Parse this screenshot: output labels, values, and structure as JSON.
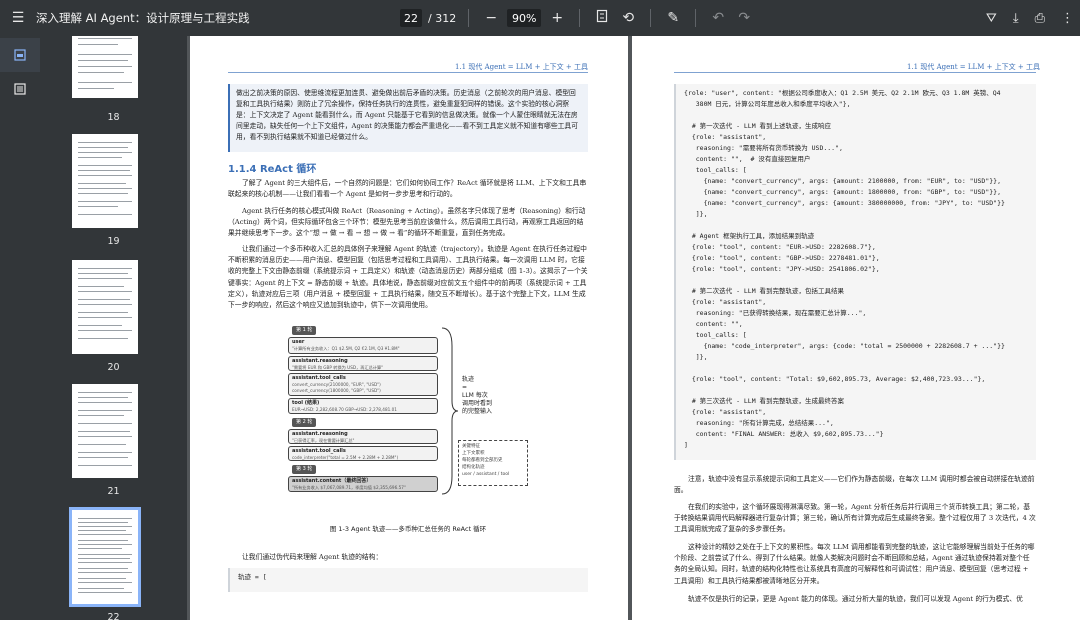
{
  "toolbar": {
    "title": "深入理解 AI Agent：设计原理与工程实践",
    "current_page": "22",
    "total_pages": "/ 312",
    "zoom": "90%"
  },
  "thumbnails": [
    {
      "num": "18"
    },
    {
      "num": "19"
    },
    {
      "num": "20"
    },
    {
      "num": "21"
    },
    {
      "num": "22"
    }
  ],
  "page_left": {
    "running_head": "1.1 现代 Agent = LLM + 上下文 + 工具",
    "callout": "做出之前决策的原因、使思维流程更加连贯、避免做出前后矛盾的决策。历史消息（之前轮次的用户消息、模型回复和工具执行结果）则防止了冗余操作，保持任务执行的连贯性，避免重复犯同样的错误。这个实验的核心洞察是：上下文决定了 Agent 能看到什么，而 Agent 只能基于它看到的信息做决策。就像一个人蒙住眼睛就无法在房间里走动，缺失任何一个上下文组件，Agent 的决策能力都会严重退化——看不到工具定义就不知道有哪些工具可用，看不到执行结果就不知道已经做过什么。",
    "section_title": "1.1.4 ReAct 循环",
    "para1": "了解了 Agent 的三大组件后，一个自然的问题是：它们如何协同工作？ReAct 循环就是将 LLM、上下文和工具串联起来的核心机制——让我们看看一个 Agent 是如何一步步思考和行动的。",
    "para2": "Agent 执行任务的核心模式叫做 ReAct（Reasoning + Acting）。虽然名字只体现了思考（Reasoning）和行动（Acting）两个词，但实际循环包含三个环节：模型先思考当前应该做什么，然后调用工具行动，再观察工具返回的结果并继续思考下一步。这个“想 → 做 → 看 → 想 → 做 → 看”的循环不断重复，直到任务完成。",
    "para3": "让我们通过一个多币种收入汇总的具体例子来理解 Agent 的轨迹（trajectory）。轨迹是 Agent 在执行任务过程中不断积累的消息历史——用户消息、模型回复（包括思考过程和工具调用）、工具执行结果。每一次调用 LLM 时，它接收的完整上下文由静态前缀（系统提示词 + 工具定义）和轨迹（动态消息历史）两部分组成（图 1-3）。这揭示了一个关键事实：Agent 的上下文 = 静态前缀 + 轨迹。具体地说，静态前缀对应前文五个组件中的前两项（系统提示词 + 工具定义），轨迹对应后三项（用户消息 + 模型回复 + 工具执行结果，随交互不断增长）。基于这个完整上下文，LLM 生成下一步的响应，然后这个响应又追加到轨迹中，供下一次调用使用。",
    "fig_caption": "图 1-3  Agent 轨迹——多币种汇总任务的 ReAct 循环",
    "para4": "让我们通过伪代码来理解 Agent 轨迹的结构：",
    "code_start": "轨迹 = ["
  },
  "figure": {
    "turn1": "第 1 轮",
    "user_title": "user",
    "user_sub": "\"计算所有业务收入：Q1 $2.5M, Q2 €2.1M, Q3 ¥1.8M\"",
    "reason1_title": "assistant.reasoning",
    "reason1_sub": "\"需要将 EUR 和 GBP 转换为 USD，再汇总计算\"",
    "tool1_title": "assistant.tool_calls",
    "tool1_sub1": "convert_currency(2100000, \"EUR\", \"USD\")",
    "tool1_sub2": "convert_currency(1800000, \"GBP\", \"USD\")",
    "toolres_title": "tool (结果)",
    "toolres_sub": "EUR→USD: 2,282,608.70      GBP→USD: 2,278,481.01",
    "turn2": "第 2 轮",
    "reason2_title": "assistant.reasoning",
    "reason2_sub": "\"已获得汇率，现在需要计算汇总\"",
    "tool2_title": "assistant.tool_calls",
    "tool2_sub": "code_interpreter(\"total = 2.5M + 2.28M + 2.28M\")",
    "turn3": "第 3 轮",
    "final_title": "assistant.content（最终回答）",
    "final_sub": "\"所有业务收入 $7,067,089.71，季度均值 $2,355,696.57\"",
    "side_label_1": "轨迹",
    "side_label_2": "=",
    "side_label_3": "LLM 每次",
    "side_label_4": "调用时看到",
    "side_label_5": "的完整输入",
    "dash_1": "关键特征",
    "dash_2": "上下文累积",
    "dash_3": "每轮都看到全部历史",
    "dash_4": "结构化轨迹",
    "dash_5": "user / assistant / tool"
  },
  "page_right": {
    "running_head": "1.1 现代 Agent = LLM + 上下文 + 工具",
    "code": "{role: \"user\", content: \"根据公司季度收入：Q1 2.5M 美元、Q2 2.1M 欧元、Q3 1.8M 英镑、Q4\n   380M 日元，计算公司年度总收入和季度平均收入\"},\n\n  # 第一次迭代 - LLM 看到上述轨迹，生成响应\n  {role: \"assistant\",\n   reasoning: \"需要将所有货币转换为 USD...\",\n   content: \"\",  # 没有直接回复用户\n   tool_calls: [\n     {name: \"convert_currency\", args: {amount: 2100000, from: \"EUR\", to: \"USD\"}},\n     {name: \"convert_currency\", args: {amount: 1800000, from: \"GBP\", to: \"USD\"}},\n     {name: \"convert_currency\", args: {amount: 380000000, from: \"JPY\", to: \"USD\"}}\n   ]},\n\n  # Agent 框架执行工具，添加结果到轨迹\n  {role: \"tool\", content: \"EUR->USD: 2282608.7\"},\n  {role: \"tool\", content: \"GBP->USD: 2278481.01\"},\n  {role: \"tool\", content: \"JPY->USD: 2541806.02\"},\n\n  # 第二次迭代 - LLM 看到完整轨迹，包括工具结果\n  {role: \"assistant\",\n   reasoning: \"已获得转换结果，现在需要汇总计算...\",\n   content: \"\",\n   tool_calls: [\n     {name: \"code_interpreter\", args: {code: \"total = 2500000 + 2282608.7 + ...\"}}\n   ]},\n\n  {role: \"tool\", content: \"Total: $9,602,895.73, Average: $2,400,723.93...\"},\n\n  # 第三次迭代 - LLM 看到完整轨迹，生成最终答案\n  {role: \"assistant\",\n   reasoning: \"所有计算完成，总结结果...\",\n   content: \"FINAL ANSWER: 总收入 $9,602,895.73...\"}\n]",
    "para1": "注意，轨迹中没有显示系统提示词和工具定义——它们作为静态前缀，在每次 LLM 调用时都会被自动拼接在轨迹前面。",
    "para2": "在我们的实验中，这个循环展现得淋漓尽致。第一轮，Agent 分析任务后并行调用三个货币转换工具；第二轮，基于转换结果调用代码解释器进行复杂计算；第三轮，确认所有计算完成后生成最终答案。整个过程仅用了 3 次迭代，4 次工具调用就完成了复杂的多步骤任务。",
    "para3": "这种设计的精妙之处在于上下文的累积性。每次 LLM 调用都能看到完整的轨迹，这让它能够理解当前处于任务的哪个阶段、之前尝试了什么、得到了什么结果。就像人类解决问题时会不断回顾和总结，Agent 通过轨迹保持着对整个任务的全局认知。同时，轨迹的结构化特性也让系统具有高度的可解释性和可调试性：用户消息、模型回复（思考过程 + 工具调用）和工具执行结果都被清晰地区分开来。",
    "para4": "轨迹不仅是执行的记录，更是 Agent 能力的体现。通过分析大量的轨迹，我们可以发现 Agent 的行为模式、优"
  }
}
